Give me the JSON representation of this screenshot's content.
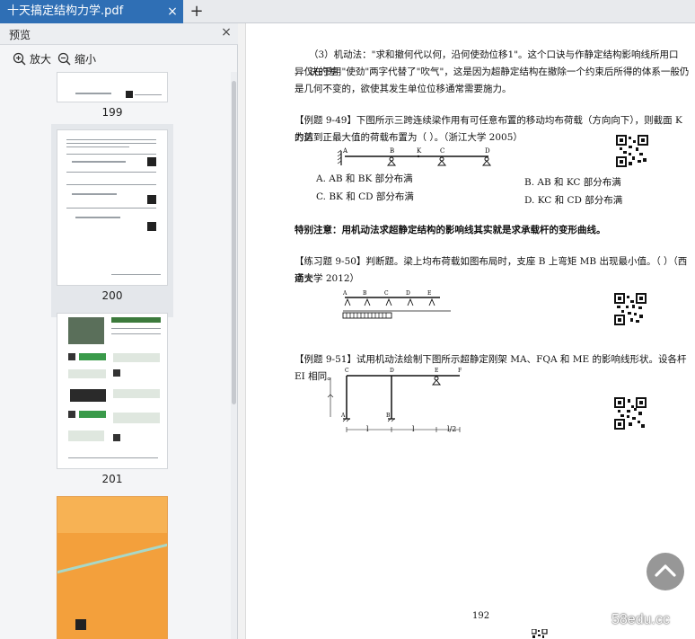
{
  "tab": {
    "title": "十天搞定结构力学.pdf",
    "close": "×",
    "new": "+"
  },
  "sidebar": {
    "title": "预览",
    "close": "×",
    "zoom_in": "放大",
    "zoom_out": "缩小",
    "pages": [
      "199",
      "200",
      "201"
    ]
  },
  "page": {
    "p1a": "（3）机动法：\"求和撤何代以何，沿何使劲位移1\"。这个口诀与作静定结构影响线所用口诀的差",
    "p1b": "异仅在于用\"使劲\"两字代替了\"吹气\"，这是因为超静定结构在撤除一个约束后所得的体系一般仍",
    "p1c": "是几何不变的，欲使其发生单位位移通常需要施力。",
    "ex49a": "【例题 9-49】下图所示三跨连续梁作用有可任意布置的移动均布荷载（方向向下），则截面 K 的剪",
    "ex49b": "力达到正最大值的荷载布置为（  ）。（浙江大学 2005）",
    "optA": "A. AB 和 BK 部分布满",
    "optB": "B. AB 和 KC 部分布满",
    "optC": "C. BK 和 CD 部分布满",
    "optD": "D. KC 和 CD 部分布满",
    "note": "特别注意：用机动法求超静定结构的影响线其实就是求承载杆的变形曲线。",
    "pr50a": "【练习题 9-50】判断题。梁上均布荷载如图布局时，支座 B 上弯矩 MB 出现最小值。（  ）（西南交",
    "pr50b": "通大学 2012）",
    "ex51": "【例题 9-51】试用机动法绘制下图所示超静定刚架 MA、FQA 和 ME 的影响线形状。设各杆 EI 相同。",
    "dim_l1": "l",
    "dim_l2": "l",
    "dim_l3": "l/2",
    "number": "192"
  },
  "watermark": "58edu.cc",
  "colors": {
    "tab_blue": "#2f6fb5",
    "thumb_orange": "#f3a03c"
  },
  "icons": [
    "zoom-in-icon",
    "zoom-out-icon",
    "close-icon",
    "chevron-up-icon"
  ]
}
